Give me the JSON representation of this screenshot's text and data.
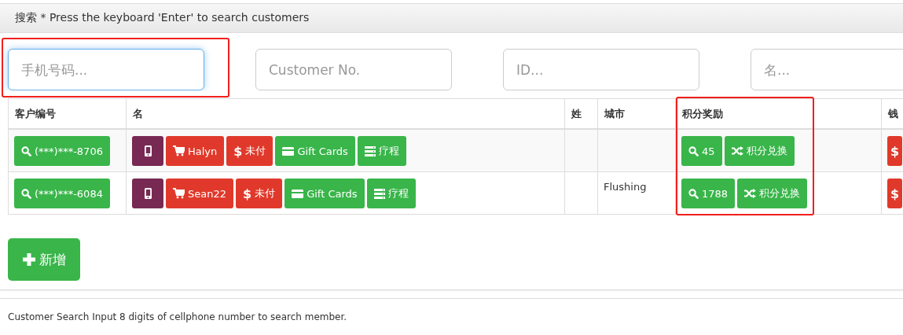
{
  "header": {
    "title": "搜索 * Press the keyboard 'Enter' to search customers"
  },
  "search_fields": [
    {
      "placeholder": "手机号码...",
      "focused": true
    },
    {
      "placeholder": "Customer No.",
      "focused": false
    },
    {
      "placeholder": "ID...",
      "focused": false
    },
    {
      "placeholder": "名...",
      "focused": false
    }
  ],
  "table": {
    "columns": [
      "客户编号",
      "名",
      "姓",
      "城市",
      "积分奖励",
      "钱"
    ],
    "rows": [
      {
        "customer_no": "(***)***-8706",
        "name_buttons": [
          {
            "kind": "phone"
          },
          {
            "kind": "cart",
            "label": "Halyn"
          },
          {
            "kind": "dollar",
            "icon": "$",
            "label": "未付"
          },
          {
            "kind": "card",
            "label": "Gift Cards"
          },
          {
            "kind": "list",
            "label": "疗程"
          }
        ],
        "points": "45",
        "exchange": "积分兑换",
        "wallet_icon": "$"
      },
      {
        "customer_no": "(***)***-6084",
        "name_buttons": [
          {
            "kind": "phone"
          },
          {
            "kind": "cart",
            "label": "Sean22"
          },
          {
            "kind": "dollar",
            "icon": "$",
            "label": "未付"
          },
          {
            "kind": "card",
            "label": "Gift Cards"
          },
          {
            "kind": "list",
            "label": "疗程"
          }
        ],
        "city": "Flushing",
        "points": "1788",
        "exchange": "积分兑换",
        "wallet_icon": "$"
      }
    ]
  },
  "add_button": {
    "label": "新增"
  },
  "footer": {
    "text": "Customer Search Input 8 digits of cellphone number to search member."
  }
}
